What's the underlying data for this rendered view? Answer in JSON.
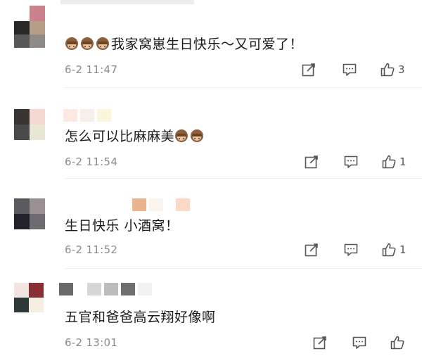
{
  "colors": {
    "timestamp": "#8a8a8a",
    "icon": "#555555",
    "divider": "#ececec",
    "text": "#1a1a1a"
  },
  "comments": [
    {
      "text": "我家窝崽生日快乐～又可爱了！",
      "emoji_prefix": [
        "see-no-evil-monkey",
        "see-no-evil-monkey",
        "see-no-evil-monkey"
      ],
      "emoji_suffix": [],
      "time": "6-2 11:47",
      "likes": "3"
    },
    {
      "text": "怎么可以比麻麻美",
      "emoji_prefix": [],
      "emoji_suffix": [
        "see-no-evil-monkey",
        "see-no-evil-monkey"
      ],
      "time": "6-2 11:54",
      "likes": "1"
    },
    {
      "text": "生日快乐 小酒窝！",
      "emoji_prefix": [],
      "emoji_suffix": [],
      "time": "6-2 11:52",
      "likes": "1"
    },
    {
      "text": "五官和爸爸高云翔好像啊",
      "emoji_prefix": [],
      "emoji_suffix": [],
      "time": "6-2 13:01",
      "likes": ""
    }
  ]
}
